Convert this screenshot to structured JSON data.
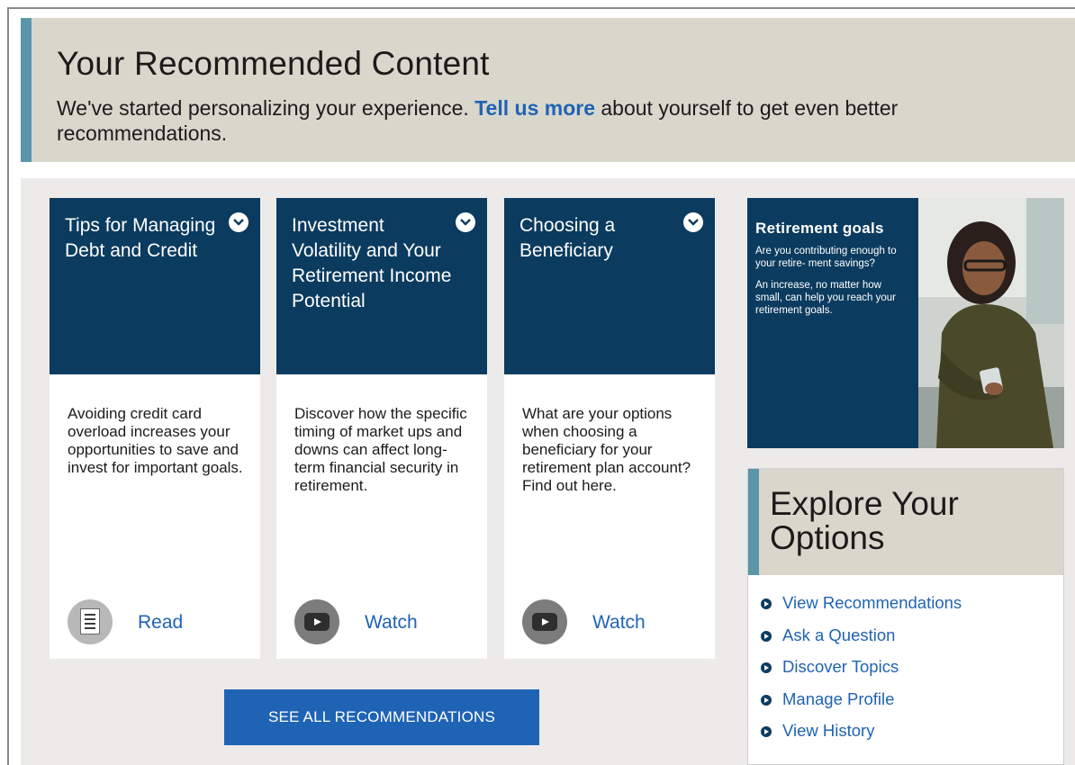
{
  "header": {
    "title": "Your Recommended Content",
    "intro_before": "We've started personalizing your experience.",
    "intro_link": "Tell us more",
    "intro_after": "about yourself to get even better recommendations."
  },
  "cards": [
    {
      "title": "Tips for Managing Debt and Credit",
      "description": "Avoiding credit card overload increases your opportunities to save and invest for important goals.",
      "action": "Read",
      "icon": "document-icon"
    },
    {
      "title": "Investment Volatility and Your Retirement Income Potential",
      "description": "Discover how the specific timing of market ups and downs can affect long-term financial security in retirement.",
      "action": "Watch",
      "icon": "video-icon"
    },
    {
      "title": "Choosing a Beneficiary",
      "description": "What are your options when choosing a beneficiary for your retirement plan account? Find out here.",
      "action": "Watch",
      "icon": "video-icon"
    }
  ],
  "see_all_label": "SEE ALL RECOMMENDATIONS",
  "promo": {
    "title": "Retirement goals",
    "line1": "Are you contributing enough to your retire- ment savings?",
    "line2": "An increase, no matter how small, can help you reach your retirement goals."
  },
  "explore": {
    "title": "Explore Your Options",
    "links": [
      "View Recommendations",
      "Ask a Question",
      "Discover Topics",
      "Manage Profile",
      "View History"
    ]
  },
  "colors": {
    "navy": "#0b3b5f",
    "link_blue": "#1f63b4",
    "teal_accent": "#5a95a8",
    "beige": "#d9d6cc",
    "panel_gray": "#edebea"
  }
}
